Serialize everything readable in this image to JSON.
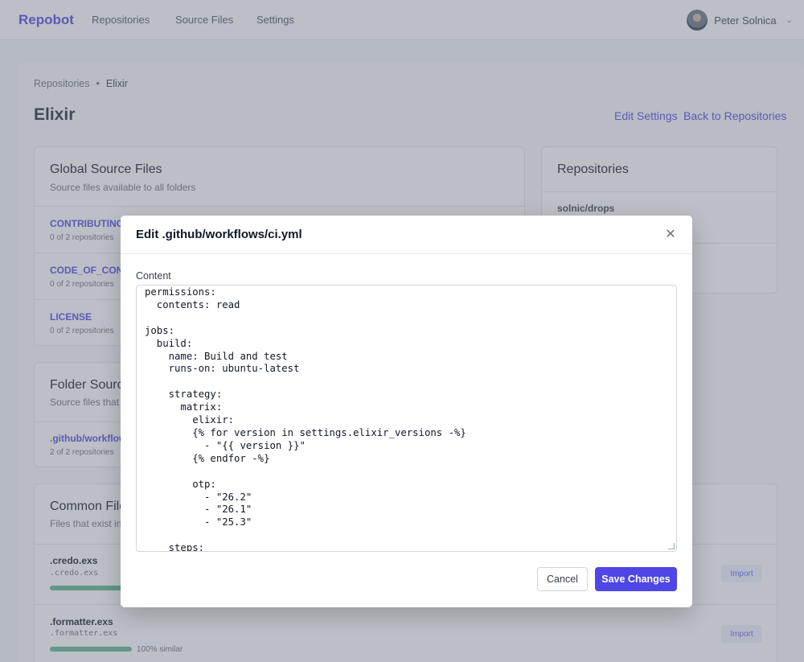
{
  "nav": {
    "brand": "Repobot",
    "links": [
      "Repositories",
      "Source Files",
      "Settings"
    ],
    "user_name": "Peter Solnica"
  },
  "breadcrumb": {
    "parent": "Repositories",
    "separator": "•",
    "current": "Elixir"
  },
  "page": {
    "title": "Elixir",
    "edit_settings": "Edit Settings",
    "back": "Back to Repositories"
  },
  "global_sources": {
    "title": "Global Source Files",
    "subtitle": "Source files available to all folders",
    "items": [
      {
        "name": "CONTRIBUTING.md",
        "meta": "0 of 2 repositories"
      },
      {
        "name": "CODE_OF_CONDUCT.md",
        "meta": "0 of 2 repositories"
      },
      {
        "name": "LICENSE",
        "meta": "0 of 2 repositories"
      }
    ]
  },
  "folder_sources": {
    "title": "Folder Source Files",
    "subtitle": "Source files that",
    "items": [
      {
        "name": ".github/workflows/ci.yml",
        "meta": "2 of 2 repositories"
      }
    ]
  },
  "common_files": {
    "title": "Common Files",
    "subtitle": "Files that exist in",
    "import_label": "Import",
    "items": [
      {
        "name": ".credo.exs",
        "path": ".credo.exs",
        "similarity": 100,
        "similarity_label": ""
      },
      {
        "name": ".formatter.exs",
        "path": ".formatter.exs",
        "similarity": 100,
        "similarity_label": "100% similar"
      }
    ]
  },
  "repositories": {
    "title": "Repositories",
    "items": [
      "solnic/drops"
    ]
  },
  "modal": {
    "title": "Edit .github/workflows/ci.yml",
    "content_label": "Content",
    "content": "permissions:\n  contents: read\n\njobs:\n  build:\n    name: Build and test\n    runs-on: ubuntu-latest\n\n    strategy:\n      matrix:\n        elixir:\n        {% for version in settings.elixir_versions -%}\n          - \"{{ version }}\"\n        {% endfor -%}\n\n        otp:\n          - \"26.2\"\n          - \"26.1\"\n          - \"25.3\"\n\n    steps:",
    "cancel": "Cancel",
    "save": "Save Changes"
  },
  "colors": {
    "accent": "#4f46e5",
    "success_bar": "#5cb68f"
  }
}
